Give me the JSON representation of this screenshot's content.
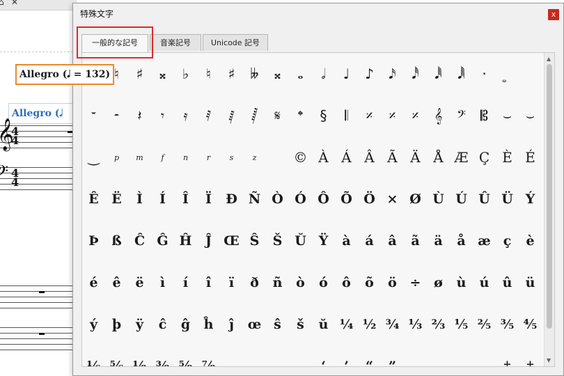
{
  "background": {
    "tab_icon": "⌂",
    "tab_close_glyph": "✕",
    "tempo_label": "Allegro (𝅘𝅥 = 132)",
    "tempo_label_blue": "Allegro (𝅗𝅥",
    "clef_treble": "𝄞",
    "clef_bass": "𝄢",
    "timesig_top": "4",
    "timesig_bottom": "4"
  },
  "dialog": {
    "title": "特殊文字",
    "close_glyph": "x",
    "tabs": [
      {
        "label": "一般的な記号",
        "active": true
      },
      {
        "label": "音楽記号",
        "active": false
      },
      {
        "label": "Unicode 記号",
        "active": false
      }
    ],
    "highlight_color": "#e0282e",
    "symbols": [
      "𝄽",
      "♮",
      "♯",
      "𝄪",
      "♭",
      "♮",
      "♯",
      "𝄫",
      "𝄪",
      "𝅝",
      "𝅗𝅥",
      "♩",
      "♪",
      "𝅘𝅥𝅯",
      "𝅘𝅥𝅰",
      "𝅘𝅥𝅱",
      "𝅘𝅥𝅲",
      "·",
      "𝆊",
      "",
      "𝄻",
      "𝄼",
      "𝄽",
      "𝄾",
      "𝄿",
      "𝅀",
      "𝅁",
      "𝅂",
      "𝄋",
      "𝄌",
      "§",
      "𝄃",
      "𝄎",
      "𝄎",
      "𝄎",
      "𝄞",
      "𝄢",
      "𝄡",
      "⌣",
      "⌣",
      "‿",
      "p",
      "m",
      "f",
      "n",
      "r",
      "s",
      "z",
      "",
      "©",
      "À",
      "Á",
      "Â",
      "Ã",
      "Ä",
      "Å",
      "Æ",
      "Ç",
      "È",
      "É",
      "Ê",
      "Ë",
      "Ì",
      "Í",
      "Î",
      "Ï",
      "Ð",
      "Ñ",
      "Ò",
      "Ó",
      "Ô",
      "Õ",
      "Ö",
      "×",
      "Ø",
      "Ù",
      "Ú",
      "Û",
      "Ü",
      "Ý",
      "Þ",
      "ß",
      "Ĉ",
      "Ĝ",
      "Ĥ",
      "Ĵ",
      "Œ",
      "Ŝ",
      "Š",
      "Ŭ",
      "Ÿ",
      "à",
      "á",
      "â",
      "ã",
      "ä",
      "å",
      "æ",
      "ç",
      "è",
      "é",
      "ê",
      "ë",
      "ì",
      "í",
      "î",
      "ï",
      "ð",
      "ñ",
      "ò",
      "ó",
      "ô",
      "õ",
      "ö",
      "÷",
      "ø",
      "ù",
      "ú",
      "û",
      "ü",
      "ý",
      "þ",
      "ÿ",
      "ĉ",
      "ĝ",
      "ĥ",
      "ĵ",
      "œ",
      "ŝ",
      "š",
      "ŭ",
      "¼",
      "½",
      "¾",
      "⅓",
      "⅔",
      "⅕",
      "⅖",
      "⅗",
      "⅘",
      "⅙",
      "⅚",
      "⅛",
      "⅜",
      "⅝",
      "⅞",
      "",
      "",
      "",
      "",
      "‘",
      "’",
      "“",
      "”",
      "",
      "",
      "",
      "",
      "†",
      "‡"
    ]
  }
}
